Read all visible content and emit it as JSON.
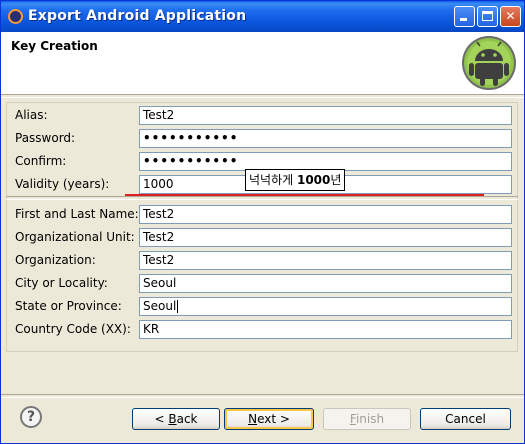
{
  "window": {
    "title": "Export Android Application",
    "controls": {
      "minimize_icon": "minimize-icon",
      "maximize_icon": "maximize-icon",
      "close_icon": "close-icon",
      "close_label": "✕"
    }
  },
  "header": {
    "title": "Key Creation",
    "logo_icon": "android-logo-icon"
  },
  "form": {
    "alias": {
      "label": "Alias:",
      "value": "Test2"
    },
    "password": {
      "label": "Password:",
      "value": "•••••••••••"
    },
    "confirm": {
      "label": "Confirm:",
      "value": "•••••••••••"
    },
    "validity": {
      "label": "Validity (years):",
      "value": "1000"
    },
    "name": {
      "label": "First and Last Name:",
      "value": "Test2"
    },
    "org_unit": {
      "label": "Organizational Unit:",
      "value": "Test2"
    },
    "org": {
      "label": "Organization:",
      "value": "Test2"
    },
    "city": {
      "label": "City or Locality:",
      "value": "Seoul"
    },
    "state": {
      "label": "State or Province:",
      "value": "Seoul"
    },
    "country": {
      "label": "Country Code (XX):",
      "value": "KR"
    }
  },
  "annotation": {
    "prefix": "넉넉하게 ",
    "bold": "1000",
    "suffix": "년",
    "line_color": "#e02020"
  },
  "footer": {
    "help_icon": "help-icon",
    "help_glyph": "?",
    "back": {
      "mnemonic": "B",
      "rest": "ack",
      "arrow": "< "
    },
    "next": {
      "mnemonic": "N",
      "rest": "ext",
      "arrow": " >"
    },
    "finish": {
      "mnemonic": "F",
      "rest": "inish"
    },
    "cancel": {
      "label": "Cancel"
    }
  }
}
